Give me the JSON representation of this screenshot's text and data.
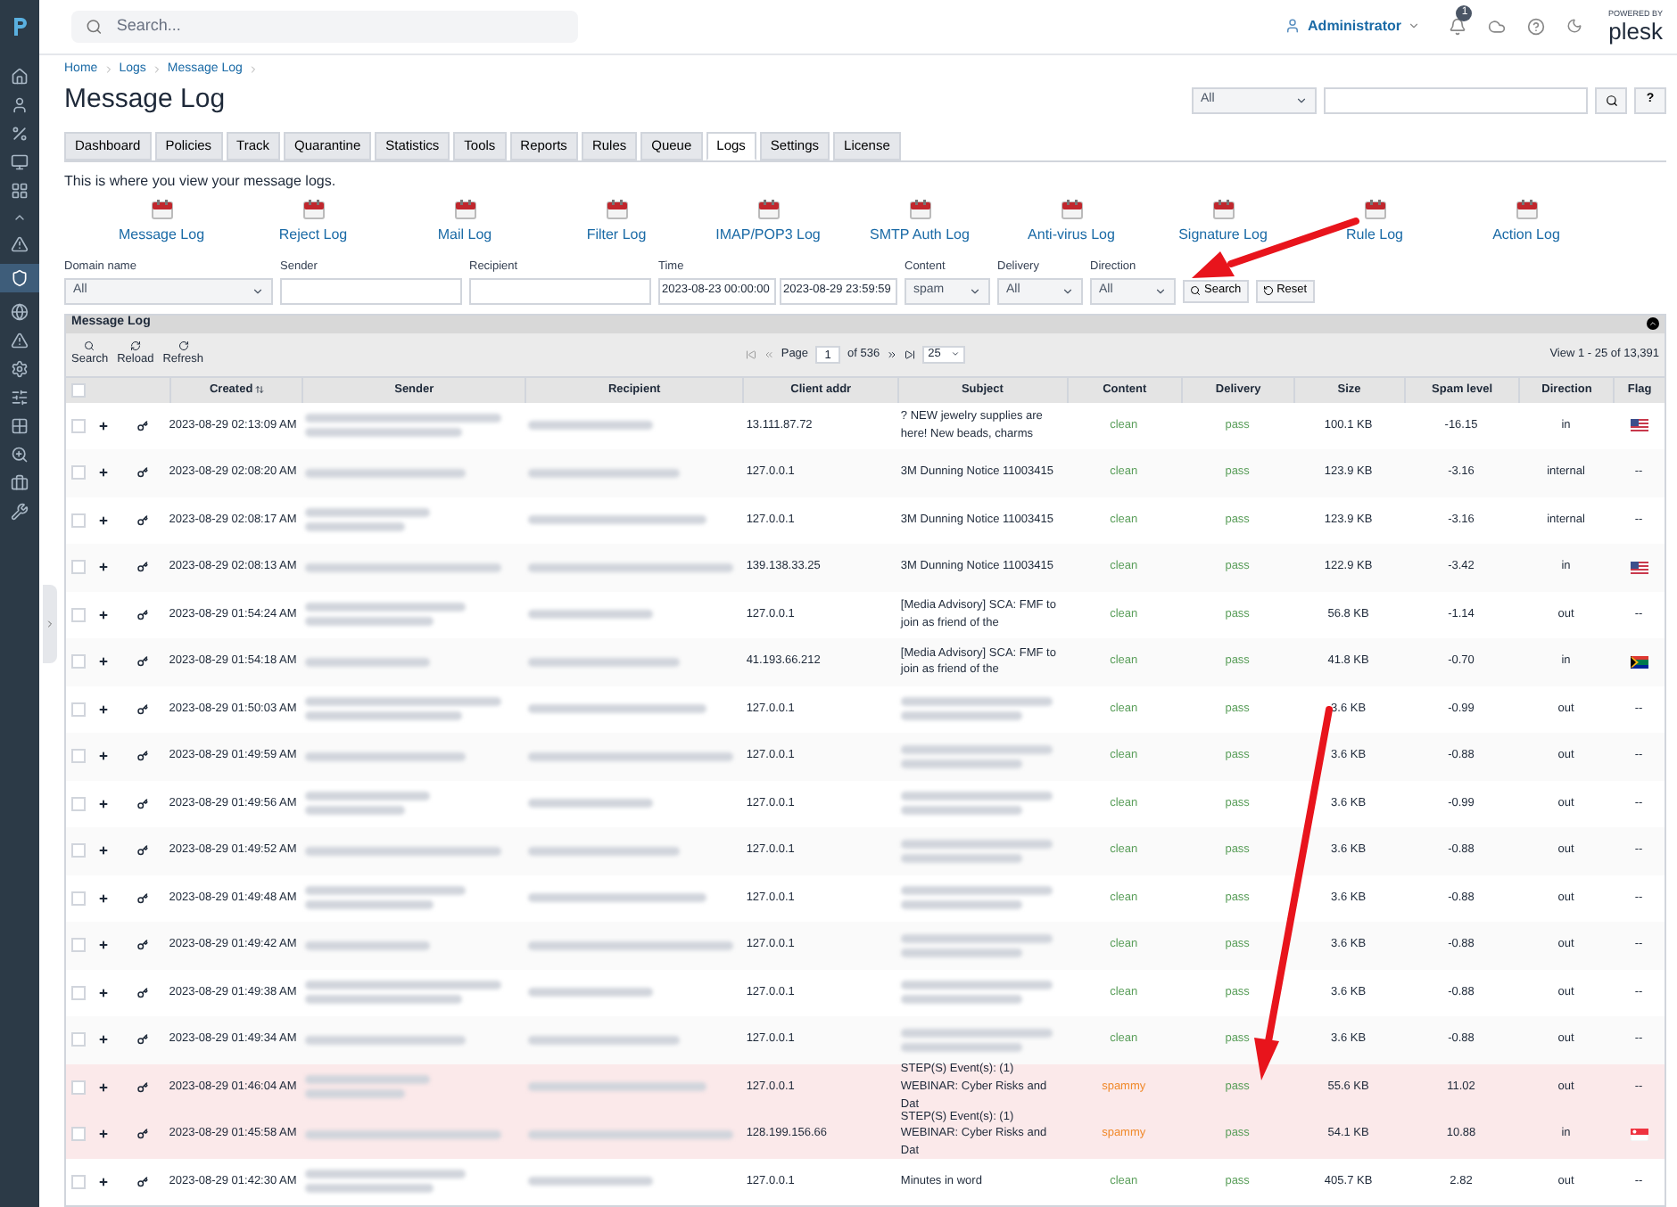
{
  "topbar": {
    "search_placeholder": "Search...",
    "user": "Administrator",
    "notification_count": "1",
    "brand_caption": "POWERED BY",
    "brand": "plesk"
  },
  "breadcrumb": [
    "Home",
    "Logs",
    "Message Log"
  ],
  "title": "Message Log",
  "quick_search": {
    "scope": "All",
    "help": "?"
  },
  "tabs": [
    {
      "label": "Dashboard",
      "selected": false
    },
    {
      "label": "Policies",
      "selected": false
    },
    {
      "label": "Track",
      "selected": false
    },
    {
      "label": "Quarantine",
      "selected": false
    },
    {
      "label": "Statistics",
      "selected": false
    },
    {
      "label": "Tools",
      "selected": false
    },
    {
      "label": "Reports",
      "selected": false
    },
    {
      "label": "Rules",
      "selected": false
    },
    {
      "label": "Queue",
      "selected": false
    },
    {
      "label": "Logs",
      "selected": true
    },
    {
      "label": "Settings",
      "selected": false
    },
    {
      "label": "License",
      "selected": false
    }
  ],
  "description": "This is where you view your message logs.",
  "log_links": [
    "Message Log",
    "Reject Log",
    "Mail Log",
    "Filter Log",
    "IMAP/POP3 Log",
    "SMTP Auth Log",
    "Anti-virus Log",
    "Signature Log",
    "Rule Log",
    "Action Log"
  ],
  "filters": [
    {
      "kind": "select",
      "label": "Domain name",
      "value": "All"
    },
    {
      "kind": "input",
      "label": "Sender"
    },
    {
      "kind": "input",
      "label": "Recipient"
    },
    {
      "kind": "range",
      "label": "Time",
      "value": "2023-08-23 00:00:00",
      "value_to": "2023-08-29 23:59:59"
    },
    {
      "kind": "select",
      "label": "Content",
      "value": "spam"
    },
    {
      "kind": "select",
      "label": "Delivery",
      "value": "All"
    },
    {
      "kind": "select",
      "label": "Direction",
      "value": "All"
    }
  ],
  "filter_buttons": [
    "Search",
    "Reset"
  ],
  "panel": {
    "title": "Message Log",
    "all_checked": false,
    "tools": [
      "Search",
      "Reload",
      "Refresh"
    ],
    "page_label": "Page",
    "page": "1",
    "page_total": "of 536",
    "page_size": "25",
    "view_info": "View 1 - 25 of 13,391"
  },
  "columns": [
    "Created",
    "Sender",
    "Recipient",
    "Client addr",
    "Subject",
    "Content",
    "Delivery",
    "Size",
    "Spam level",
    "Direction",
    "Flag"
  ],
  "rows": [
    {
      "checked": false,
      "created": "2023-08-29 02:13:09 AM",
      "client": "13.111.87.72",
      "subject": "? NEW jewelry supplies are here! New beads, charms",
      "content": "clean",
      "spammy": false,
      "delivery": "pass",
      "size": "100.1 KB",
      "spam_level": "-16.15",
      "direction": "in",
      "flag": {
        "kind": "us"
      }
    },
    {
      "checked": false,
      "created": "2023-08-29 02:08:20 AM",
      "client": "127.0.0.1",
      "subject": "3M Dunning Notice 11003415",
      "content": "clean",
      "spammy": false,
      "delivery": "pass",
      "size": "123.9 KB",
      "spam_level": "-3.16",
      "direction": "internal",
      "flag_text": "--"
    },
    {
      "checked": false,
      "created": "2023-08-29 02:08:17 AM",
      "client": "127.0.0.1",
      "subject": "3M Dunning Notice 11003415",
      "content": "clean",
      "spammy": false,
      "delivery": "pass",
      "size": "123.9 KB",
      "spam_level": "-3.16",
      "direction": "internal",
      "flag_text": "--"
    },
    {
      "checked": false,
      "created": "2023-08-29 02:08:13 AM",
      "client": "139.138.33.25",
      "subject": "3M Dunning Notice 11003415",
      "content": "clean",
      "spammy": false,
      "delivery": "pass",
      "size": "122.9 KB",
      "spam_level": "-3.42",
      "direction": "in",
      "flag": {
        "kind": "us"
      }
    },
    {
      "checked": false,
      "created": "2023-08-29 01:54:24 AM",
      "client": "127.0.0.1",
      "subject": "[Media Advisory] SCA: FMF to join as friend of the",
      "content": "clean",
      "spammy": false,
      "delivery": "pass",
      "size": "56.8 KB",
      "spam_level": "-1.14",
      "direction": "out",
      "flag_text": "--"
    },
    {
      "checked": false,
      "created": "2023-08-29 01:54:18 AM",
      "client": "41.193.66.212",
      "subject": "[Media Advisory] SCA: FMF to join as friend of the",
      "content": "clean",
      "spammy": false,
      "delivery": "pass",
      "size": "41.8 KB",
      "spam_level": "-0.70",
      "direction": "in",
      "flag": {
        "kind": "za"
      }
    },
    {
      "checked": false,
      "created": "2023-08-29 01:50:03 AM",
      "client": "127.0.0.1",
      "content": "clean",
      "spammy": false,
      "delivery": "pass",
      "size": "3.6 KB",
      "spam_level": "-0.99",
      "direction": "out",
      "flag_text": "--"
    },
    {
      "checked": false,
      "created": "2023-08-29 01:49:59 AM",
      "client": "127.0.0.1",
      "content": "clean",
      "spammy": false,
      "delivery": "pass",
      "size": "3.6 KB",
      "spam_level": "-0.88",
      "direction": "out",
      "flag_text": "--"
    },
    {
      "checked": false,
      "created": "2023-08-29 01:49:56 AM",
      "client": "127.0.0.1",
      "content": "clean",
      "spammy": false,
      "delivery": "pass",
      "size": "3.6 KB",
      "spam_level": "-0.99",
      "direction": "out",
      "flag_text": "--"
    },
    {
      "checked": false,
      "created": "2023-08-29 01:49:52 AM",
      "client": "127.0.0.1",
      "content": "clean",
      "spammy": false,
      "delivery": "pass",
      "size": "3.6 KB",
      "spam_level": "-0.88",
      "direction": "out",
      "flag_text": "--"
    },
    {
      "checked": false,
      "created": "2023-08-29 01:49:48 AM",
      "client": "127.0.0.1",
      "content": "clean",
      "spammy": false,
      "delivery": "pass",
      "size": "3.6 KB",
      "spam_level": "-0.88",
      "direction": "out",
      "flag_text": "--"
    },
    {
      "checked": false,
      "created": "2023-08-29 01:49:42 AM",
      "client": "127.0.0.1",
      "content": "clean",
      "spammy": false,
      "delivery": "pass",
      "size": "3.6 KB",
      "spam_level": "-0.88",
      "direction": "out",
      "flag_text": "--"
    },
    {
      "checked": false,
      "created": "2023-08-29 01:49:38 AM",
      "client": "127.0.0.1",
      "content": "clean",
      "spammy": false,
      "delivery": "pass",
      "size": "3.6 KB",
      "spam_level": "-0.88",
      "direction": "out",
      "flag_text": "--"
    },
    {
      "checked": false,
      "created": "2023-08-29 01:49:34 AM",
      "client": "127.0.0.1",
      "content": "clean",
      "spammy": false,
      "delivery": "pass",
      "size": "3.6 KB",
      "spam_level": "-0.88",
      "direction": "out",
      "flag_text": "--"
    },
    {
      "checked": false,
      "created": "2023-08-29 01:46:04 AM",
      "client": "127.0.0.1",
      "subject": "STEP(S) Event(s): (1) WEBINAR: Cyber Risks and Dat",
      "content": "spammy",
      "spammy": true,
      "delivery": "pass",
      "size": "55.6 KB",
      "spam_level": "11.02",
      "direction": "out",
      "flag_text": "--"
    },
    {
      "checked": false,
      "created": "2023-08-29 01:45:58 AM",
      "client": "128.199.156.66",
      "subject": "STEP(S) Event(s): (1) WEBINAR: Cyber Risks and Dat",
      "content": "spammy",
      "spammy": true,
      "delivery": "pass",
      "size": "54.1 KB",
      "spam_level": "10.88",
      "direction": "in",
      "flag": {
        "kind": "sg"
      }
    },
    {
      "checked": false,
      "created": "2023-08-29 01:42:30 AM",
      "client": "127.0.0.1",
      "subject": "Minutes in word",
      "content": "clean",
      "spammy": false,
      "delivery": "pass",
      "size": "405.7 KB",
      "spam_level": "2.82",
      "direction": "out",
      "flag_text": "--"
    }
  ]
}
